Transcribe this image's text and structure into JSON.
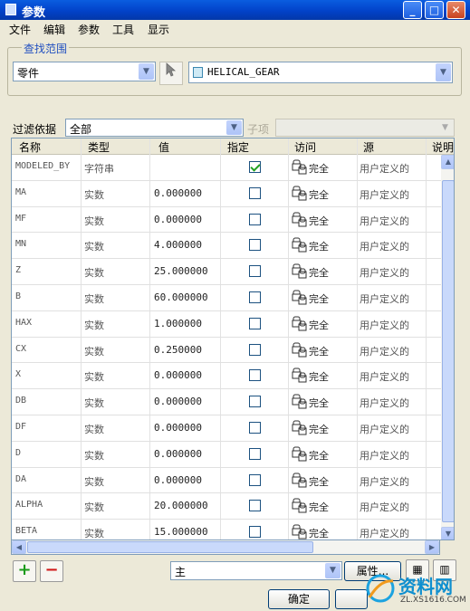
{
  "window": {
    "title": "参数",
    "icon": "document-icon"
  },
  "menu": [
    "文件",
    "编辑",
    "参数",
    "工具",
    "显示"
  ],
  "scope": {
    "section_label": "查找范围",
    "type_value": "零件",
    "selection_icon": "pointer-icon",
    "model_value": "HELICAL_GEAR"
  },
  "filter": {
    "label": "过滤依据",
    "value": "全部",
    "sub_label": "子项",
    "sub_value": ""
  },
  "table": {
    "headers": [
      "名称",
      "类型",
      "值",
      "指定",
      "访问",
      "源",
      "说明"
    ],
    "rows": [
      {
        "name": "MODELED_BY",
        "type": "字符串",
        "value": "",
        "designated": true,
        "access": "完全",
        "source": "用户定义的"
      },
      {
        "name": "MA",
        "type": "实数",
        "value": "0.000000",
        "designated": false,
        "access": "完全",
        "source": "用户定义的"
      },
      {
        "name": "MF",
        "type": "实数",
        "value": "0.000000",
        "designated": false,
        "access": "完全",
        "source": "用户定义的"
      },
      {
        "name": "MN",
        "type": "实数",
        "value": "4.000000",
        "designated": false,
        "access": "完全",
        "source": "用户定义的"
      },
      {
        "name": "Z",
        "type": "实数",
        "value": "25.000000",
        "designated": false,
        "access": "完全",
        "source": "用户定义的"
      },
      {
        "name": "B",
        "type": "实数",
        "value": "60.000000",
        "designated": false,
        "access": "完全",
        "source": "用户定义的"
      },
      {
        "name": "HAX",
        "type": "实数",
        "value": "1.000000",
        "designated": false,
        "access": "完全",
        "source": "用户定义的"
      },
      {
        "name": "CX",
        "type": "实数",
        "value": "0.250000",
        "designated": false,
        "access": "完全",
        "source": "用户定义的"
      },
      {
        "name": "X",
        "type": "实数",
        "value": "0.000000",
        "designated": false,
        "access": "完全",
        "source": "用户定义的"
      },
      {
        "name": "DB",
        "type": "实数",
        "value": "0.000000",
        "designated": false,
        "access": "完全",
        "source": "用户定义的"
      },
      {
        "name": "DF",
        "type": "实数",
        "value": "0.000000",
        "designated": false,
        "access": "完全",
        "source": "用户定义的"
      },
      {
        "name": "D",
        "type": "实数",
        "value": "0.000000",
        "designated": false,
        "access": "完全",
        "source": "用户定义的"
      },
      {
        "name": "DA",
        "type": "实数",
        "value": "0.000000",
        "designated": false,
        "access": "完全",
        "source": "用户定义的"
      },
      {
        "name": "ALPHA",
        "type": "实数",
        "value": "20.000000",
        "designated": false,
        "access": "完全",
        "source": "用户定义的"
      },
      {
        "name": "BETA",
        "type": "实数",
        "value": "15.000000",
        "designated": false,
        "access": "完全",
        "source": "用户定义的"
      }
    ]
  },
  "footer": {
    "add_icon": "plus-icon",
    "remove_icon": "minus-icon",
    "main_value": "主",
    "properties_label": "属性...",
    "ok_label": "确定"
  },
  "watermark": {
    "text": "资料网",
    "url": "ZL.XS1616.COM"
  },
  "colors": {
    "title_bar": "#0242c9",
    "accent_label": "#2150c0",
    "plus": "#1a9a1a",
    "minus": "#d01818"
  }
}
